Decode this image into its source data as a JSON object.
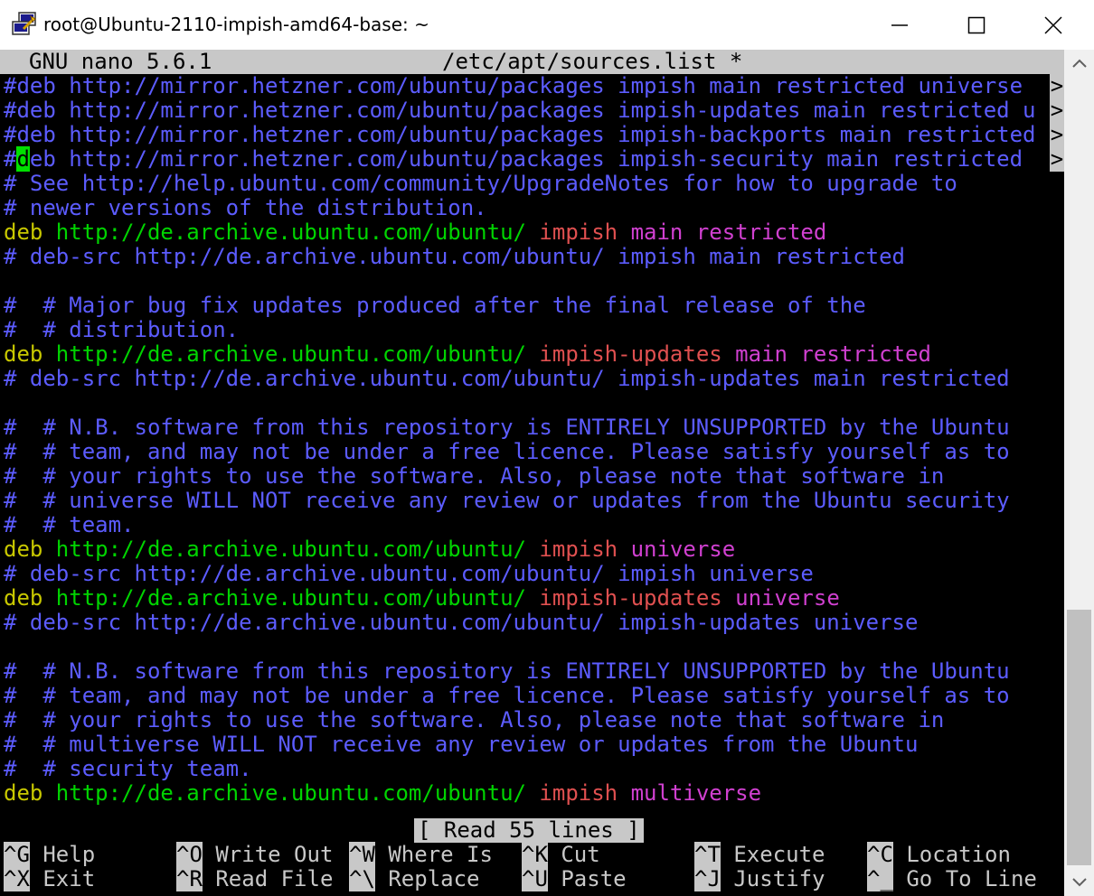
{
  "window": {
    "title": "root@Ubuntu-2110-impish-amd64-base: ~",
    "icon": "putty-icon"
  },
  "nano": {
    "version": "GNU nano 5.6.1",
    "filename": "/etc/apt/sources.list *",
    "lines": [
      [
        {
          "t": "#deb http://mirror.hetzner.com/ubuntu/packages impish main restricted universe ",
          "c": "blue"
        }
      ],
      [
        {
          "t": "#deb http://mirror.hetzner.com/ubuntu/packages impish-updates main restricted u",
          "c": "blue"
        }
      ],
      [
        {
          "t": "#deb http://mirror.hetzner.com/ubuntu/packages impish-backports main restricted",
          "c": "blue"
        }
      ],
      [
        {
          "t": "#",
          "c": "blue"
        },
        {
          "t": "d",
          "c": "cursor"
        },
        {
          "t": "eb http://mirror.hetzner.com/ubuntu/packages impish-security main restricted ",
          "c": "blue"
        }
      ],
      [
        {
          "t": "# See http://help.ubuntu.com/community/UpgradeNotes for how to upgrade to",
          "c": "blue"
        }
      ],
      [
        {
          "t": "# newer versions of the distribution.",
          "c": "blue"
        }
      ],
      [
        {
          "t": "deb ",
          "c": "yellow"
        },
        {
          "t": "http://de.archive.ubuntu.com/ubuntu/ ",
          "c": "green"
        },
        {
          "t": "impish ",
          "c": "red"
        },
        {
          "t": "main ",
          "c": "magenta"
        },
        {
          "t": "restricted",
          "c": "magenta"
        }
      ],
      [
        {
          "t": "# deb-src http://de.archive.ubuntu.com/ubuntu/ impish main restricted",
          "c": "blue"
        }
      ],
      [],
      [
        {
          "t": "#  # Major bug fix updates produced after the final release of the",
          "c": "blue"
        }
      ],
      [
        {
          "t": "#  # distribution.",
          "c": "blue"
        }
      ],
      [
        {
          "t": "deb ",
          "c": "yellow"
        },
        {
          "t": "http://de.archive.ubuntu.com/ubuntu/ ",
          "c": "green"
        },
        {
          "t": "impish-updates ",
          "c": "red"
        },
        {
          "t": "main ",
          "c": "magenta"
        },
        {
          "t": "restricted",
          "c": "magenta"
        }
      ],
      [
        {
          "t": "# deb-src http://de.archive.ubuntu.com/ubuntu/ impish-updates main restricted",
          "c": "blue"
        }
      ],
      [],
      [
        {
          "t": "#  # N.B. software from this repository is ENTIRELY UNSUPPORTED by the Ubuntu",
          "c": "blue"
        }
      ],
      [
        {
          "t": "#  # team, and may not be under a free licence. Please satisfy yourself as to",
          "c": "blue"
        }
      ],
      [
        {
          "t": "#  # your rights to use the software. Also, please note that software in",
          "c": "blue"
        }
      ],
      [
        {
          "t": "#  # universe WILL NOT receive any review or updates from the Ubuntu security",
          "c": "blue"
        }
      ],
      [
        {
          "t": "#  # team.",
          "c": "blue"
        }
      ],
      [
        {
          "t": "deb ",
          "c": "yellow"
        },
        {
          "t": "http://de.archive.ubuntu.com/ubuntu/ ",
          "c": "green"
        },
        {
          "t": "impish ",
          "c": "red"
        },
        {
          "t": "universe",
          "c": "magenta"
        }
      ],
      [
        {
          "t": "# deb-src http://de.archive.ubuntu.com/ubuntu/ impish universe",
          "c": "blue"
        }
      ],
      [
        {
          "t": "deb ",
          "c": "yellow"
        },
        {
          "t": "http://de.archive.ubuntu.com/ubuntu/ ",
          "c": "green"
        },
        {
          "t": "impish-updates ",
          "c": "red"
        },
        {
          "t": "universe",
          "c": "magenta"
        }
      ],
      [
        {
          "t": "# deb-src http://de.archive.ubuntu.com/ubuntu/ impish-updates universe",
          "c": "blue"
        }
      ],
      [],
      [
        {
          "t": "#  # N.B. software from this repository is ENTIRELY UNSUPPORTED by the Ubuntu",
          "c": "blue"
        }
      ],
      [
        {
          "t": "#  # team, and may not be under a free licence. Please satisfy yourself as to",
          "c": "blue"
        }
      ],
      [
        {
          "t": "#  # your rights to use the software. Also, please note that software in",
          "c": "blue"
        }
      ],
      [
        {
          "t": "#  # multiverse WILL NOT receive any review or updates from the Ubuntu",
          "c": "blue"
        }
      ],
      [
        {
          "t": "#  # security team.",
          "c": "blue"
        }
      ],
      [
        {
          "t": "deb ",
          "c": "yellow"
        },
        {
          "t": "http://de.archive.ubuntu.com/ubuntu/ ",
          "c": "green"
        },
        {
          "t": "impish ",
          "c": "red"
        },
        {
          "t": "multiverse",
          "c": "magenta"
        }
      ]
    ],
    "overflow_marker": ">",
    "status": "[ Read 55 lines ]",
    "shortcuts": [
      {
        "key": "^G",
        "label": "Help"
      },
      {
        "key": "^O",
        "label": "Write Out"
      },
      {
        "key": "^W",
        "label": "Where Is"
      },
      {
        "key": "^K",
        "label": "Cut"
      },
      {
        "key": "^T",
        "label": "Execute"
      },
      {
        "key": "^C",
        "label": "Location"
      },
      {
        "key": "^X",
        "label": "Exit"
      },
      {
        "key": "^R",
        "label": "Read File"
      },
      {
        "key": "^\\",
        "label": "Replace"
      },
      {
        "key": "^U",
        "label": "Paste"
      },
      {
        "key": "^J",
        "label": "Justify"
      },
      {
        "key": "^_",
        "label": "Go To Line"
      }
    ]
  },
  "colors": {
    "comment": "#5c5cff",
    "keyword": "#c8c800",
    "url": "#00d400",
    "suite": "#e05050",
    "component": "#d040d0",
    "cursor": "#00e000",
    "bar": "#c8c8c8"
  }
}
